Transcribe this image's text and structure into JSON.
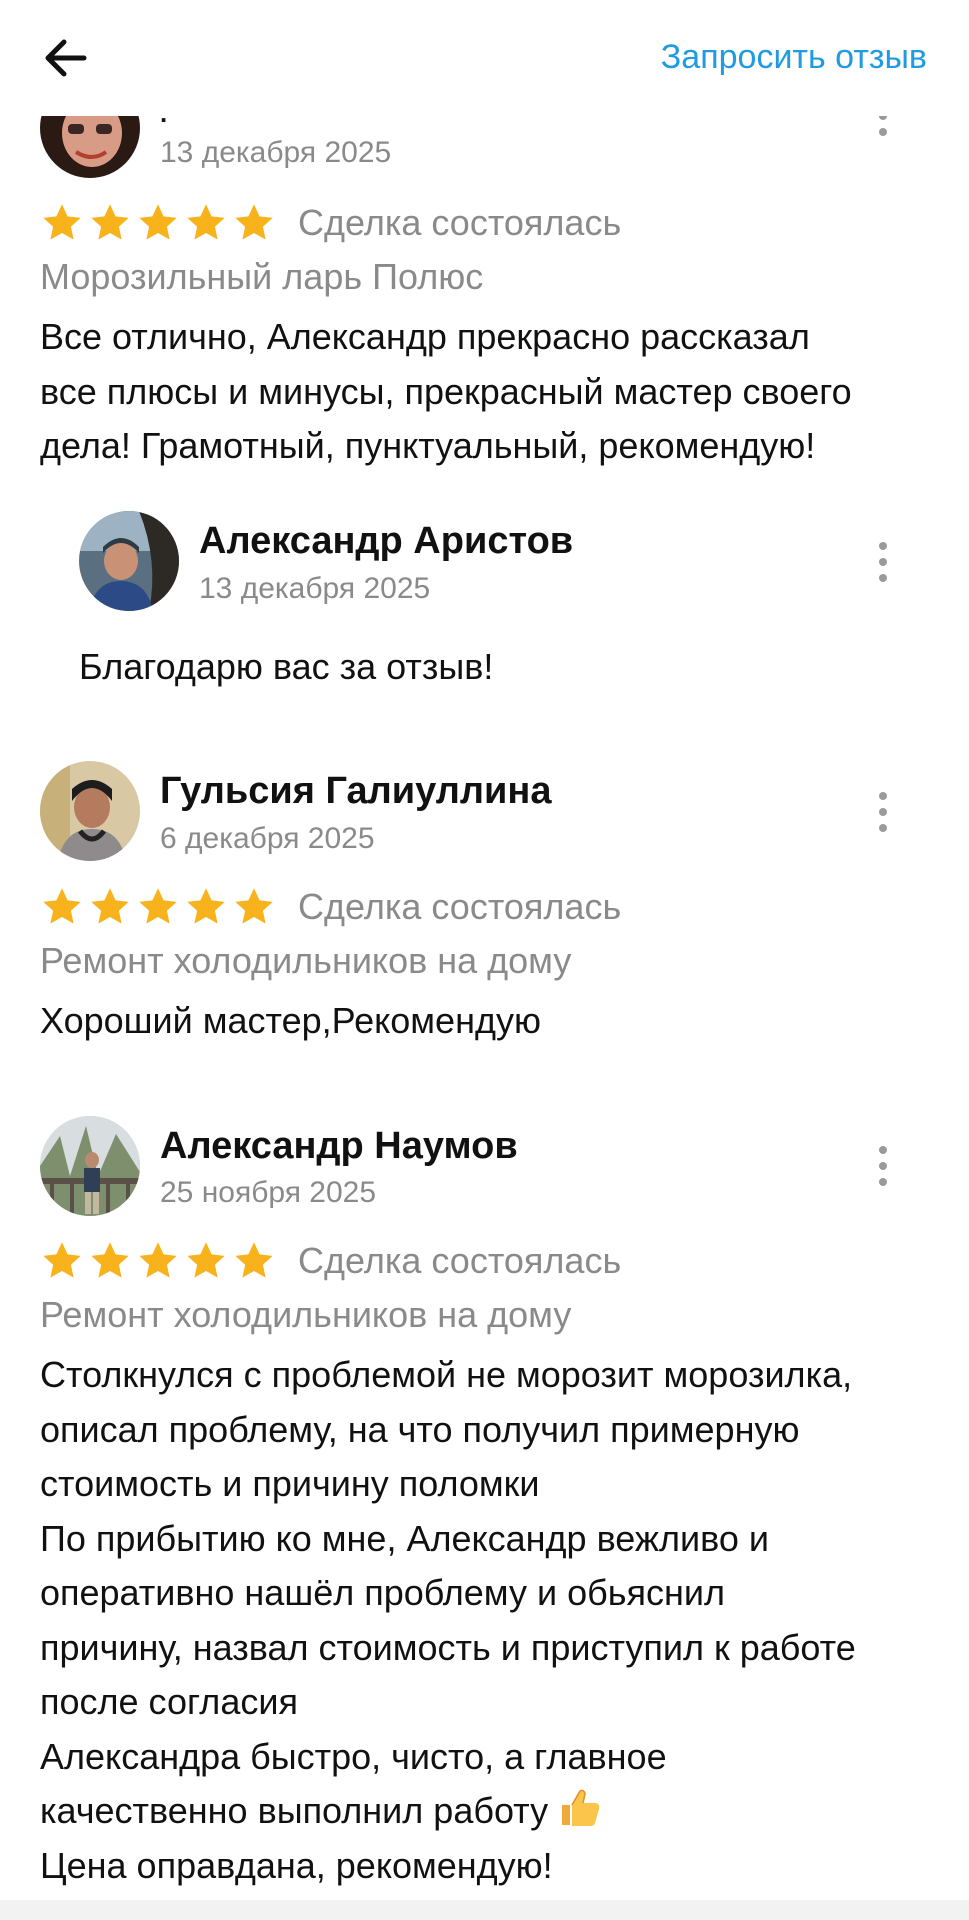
{
  "header": {
    "request_review_label": "Запросить отзыв"
  },
  "icons": {
    "back": "arrow-left-icon",
    "more": "kebab-icon",
    "star": "star-icon",
    "thumbs_up": "thumbs-up-icon"
  },
  "colors": {
    "accent": "#1f9be1",
    "star": "#f8b21c",
    "muted": "#8a8a8a",
    "text": "#111111"
  },
  "reviews": [
    {
      "author_name": ".",
      "date": "13 декабря 2025",
      "rating": 5,
      "deal_status": "Сделка состоялась",
      "category": "Морозильный ларь Полюс",
      "text_lines": [
        "Все отлично, Александр прекрасно рассказал",
        "все плюсы и минусы, прекрасный мастер своего",
        "дела! Грамотный, пунктуальный, рекомендую!"
      ],
      "reply": {
        "author_name": "Александр Аристов",
        "date": "13 декабря 2025",
        "text": "Благодарю вас за отзыв!"
      }
    },
    {
      "author_name": "Гульсия Галиуллина",
      "date": "6 декабря 2025",
      "rating": 5,
      "deal_status": "Сделка состоялась",
      "category": "Ремонт холодильников на дому",
      "text_lines": [
        "Хороший мастер,Рекомендую"
      ]
    },
    {
      "author_name": "Александр Наумов",
      "date": "25 ноября 2025",
      "rating": 5,
      "deal_status": "Сделка состоялась",
      "category": "Ремонт холодильников на дому",
      "text_lines": [
        "Столкнулся с проблемой не морозит морозилка,",
        "описал проблему, на что получил примерную",
        "стоимость и причину поломки",
        "По прибытию ко мне, Александр вежливо и",
        "оперативно нашёл проблему и обьяснил",
        "причину, назвал стоимость и приступил к работе",
        "после согласия",
        "Александра  быстро, чисто, а главное",
        "качественно выполнил работу",
        "Цена оправдана, рекомендую!"
      ]
    }
  ]
}
